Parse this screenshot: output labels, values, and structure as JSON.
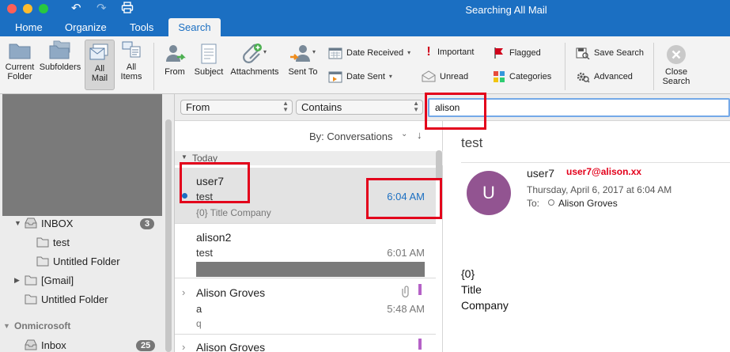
{
  "window": {
    "title": "Searching All Mail"
  },
  "titlebar": {
    "undo_icon": "undo-icon",
    "redo_icon": "redo-icon",
    "print_icon": "print-icon"
  },
  "tabs": [
    {
      "label": "Home"
    },
    {
      "label": "Organize"
    },
    {
      "label": "Tools"
    },
    {
      "label": "Search",
      "active": true
    }
  ],
  "ribbon": {
    "scope": [
      {
        "label_lines": [
          "Current",
          "Folder"
        ],
        "icon": "folder-icon"
      },
      {
        "label_lines": [
          "Subfolders"
        ],
        "icon": "subfolders-icon"
      },
      {
        "label_lines": [
          "All",
          "Mail"
        ],
        "icon": "all-mail-icon",
        "selected": true
      },
      {
        "label_lines": [
          "All",
          "Items"
        ],
        "icon": "all-items-icon"
      }
    ],
    "refine": [
      {
        "label": "From",
        "icon": "person-from-icon"
      },
      {
        "label": "Subject",
        "icon": "subject-icon"
      },
      {
        "label": "Attachments",
        "icon": "paperclip-icon"
      },
      {
        "label": "Sent To",
        "icon": "person-sent-to-icon"
      }
    ],
    "date_received": "Date Received",
    "date_sent": "Date Sent",
    "important": "Important",
    "unread": "Unread",
    "flagged": "Flagged",
    "categories": "Categories",
    "save_search": "Save Search",
    "advanced": "Advanced",
    "close_search_lines": [
      "Close",
      "Search"
    ]
  },
  "sidebar": {
    "folders": [
      {
        "label": "INBOX",
        "badge": "3"
      },
      {
        "label": "test"
      },
      {
        "label": "Untitled Folder"
      },
      {
        "label": "[Gmail]"
      },
      {
        "label": "Untitled Folder"
      }
    ],
    "account2": "Onmicrosoft",
    "inbox2": {
      "label": "Inbox",
      "badge": "25"
    }
  },
  "filter": {
    "field": "From",
    "operator": "Contains",
    "query": "alison"
  },
  "list": {
    "sort_label": "By: Conversations",
    "group_label": "Today",
    "messages": [
      {
        "from": "user7",
        "subject": "test",
        "preview": "{0} Title Company",
        "time": "6:04 AM",
        "selected": true,
        "unread": true
      },
      {
        "from": "alison2",
        "subject": "test",
        "preview": "",
        "time": "6:01 AM"
      },
      {
        "from": "Alison Groves",
        "subject": "a",
        "preview": "q",
        "time": "5:48 AM",
        "attachment": true
      },
      {
        "from": "Alison Groves",
        "subject": "",
        "preview": "",
        "time": ""
      }
    ]
  },
  "reading": {
    "subject": "test",
    "sender": "user7",
    "annotation": "user7@alison.xx",
    "avatar_letter": "U",
    "date": "Thursday, April 6, 2017 at 6:04 AM",
    "to_label": "To:",
    "to_name": "Alison Groves",
    "body_lines": [
      "{0}",
      "Title",
      "Company"
    ]
  },
  "colors": {
    "accent": "#1b6fc2",
    "annotation_red": "#e3001b",
    "avatar": "#925491",
    "category_purple": "#b562c7"
  }
}
